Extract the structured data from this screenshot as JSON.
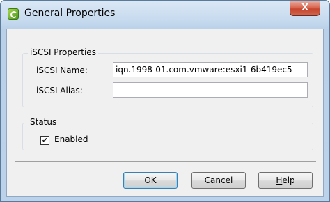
{
  "window": {
    "title": "General Properties",
    "close_glyph": "X",
    "app_icon": "vsphere-icon"
  },
  "iscsi_properties": {
    "group_label": "iSCSI Properties",
    "name_label": "iSCSI Name:",
    "name_value": "iqn.1998-01.com.vmware:esxi1-6b419ec5",
    "alias_label": "iSCSI Alias:",
    "alias_value": ""
  },
  "status": {
    "group_label": "Status",
    "enabled_label": "Enabled",
    "enabled_checked": true,
    "check_glyph": "✔"
  },
  "buttons": {
    "ok": "OK",
    "cancel": "Cancel",
    "help_mnemonic": "H",
    "help_rest": "elp"
  }
}
